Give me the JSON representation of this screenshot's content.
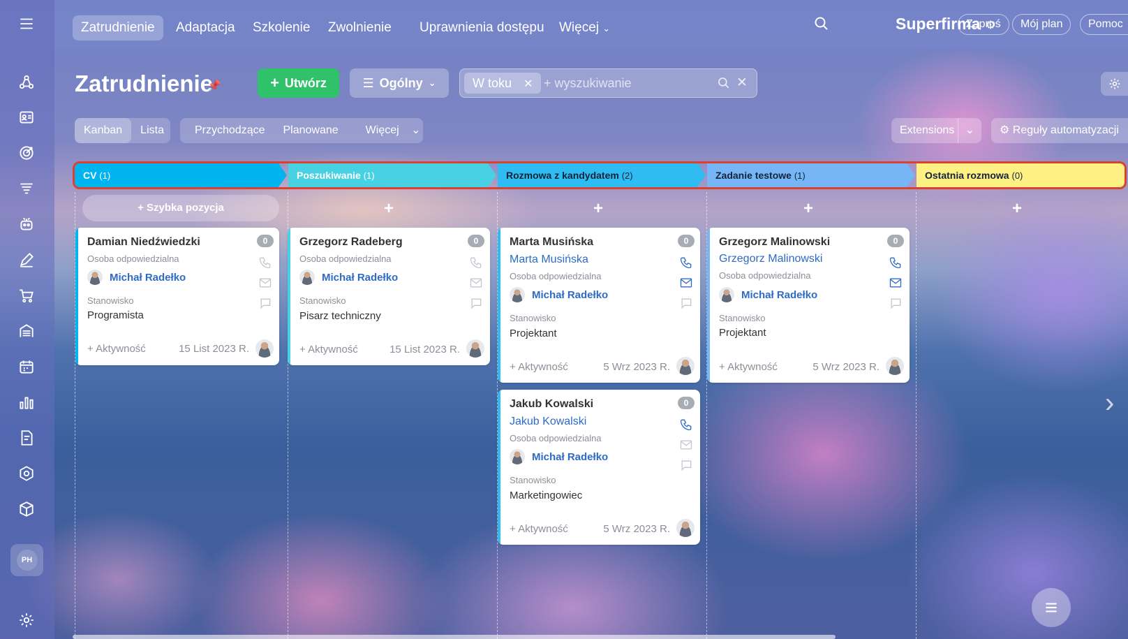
{
  "nav": {
    "tabs": [
      "Zatrudnienie",
      "Adaptacja",
      "Szkolenie",
      "Zwolnienie",
      "Uprawnienia dostępu",
      "Więcej"
    ],
    "brand": "Superfirma",
    "invite": "Zaproś",
    "my_plan": "Mój plan",
    "help": "Pomoc"
  },
  "sidebar": {
    "avatar_initials": "PH",
    "icons": [
      "menu-icon",
      "crm-icon",
      "contacts-icon",
      "goal-icon",
      "filter-icon",
      "robot-icon",
      "sign-icon",
      "cart-icon",
      "warehouse-icon",
      "calendar-icon",
      "analytics-icon",
      "document-icon",
      "hexagon-icon",
      "package-icon",
      "settings-icon"
    ]
  },
  "toolbar": {
    "title": "Zatrudnienie",
    "create": "Utwórz",
    "general": "Ogólny",
    "filter_chip": "W toku",
    "search_placeholder": "+ wyszukiwanie"
  },
  "views": {
    "kanban": "Kanban",
    "list": "Lista",
    "incoming": "Przychodzące",
    "planned": "Planowane",
    "more": "Więcej",
    "extensions": "Extensions",
    "automation": "Reguły automatyzacji"
  },
  "quick_add": "Szybka pozycja",
  "stages": [
    {
      "name": "CV",
      "count": "(1)",
      "color": "#00b4f0"
    },
    {
      "name": "Poszukiwanie",
      "count": "(1)",
      "color": "#47d1e2"
    },
    {
      "name": "Rozmowa z kandydatem",
      "count": "(2)",
      "color": "#2fbcf2"
    },
    {
      "name": "Zadanie testowe",
      "count": "(1)",
      "color": "#76b6f7"
    },
    {
      "name": "Ostatnia rozmowa",
      "count": "(0)",
      "color": "#fff084"
    }
  ],
  "labels": {
    "responsible": "Osoba odpowiedzialna",
    "position": "Stanowisko",
    "activity": "+ Aktywność"
  },
  "cards": [
    {
      "name": "Damian Niedźwiedzki",
      "responsible": "Michał Radełko",
      "position": "Programista",
      "date": "15 List 2023 R.",
      "badge": "0"
    },
    {
      "name": "Grzegorz Radeberg",
      "responsible": "Michał Radełko",
      "position": "Pisarz techniczny",
      "date": "15 List 2023 R.",
      "badge": "0"
    },
    {
      "name": "Marta Musińska",
      "contact": "Marta Musińska",
      "responsible": "Michał Radełko",
      "position": "Projektant",
      "date": "5 Wrz 2023 R.",
      "badge": "0"
    },
    {
      "name": "Jakub Kowalski",
      "contact": "Jakub Kowalski",
      "responsible": "Michał Radełko",
      "position": "Marketingowiec",
      "date": "5 Wrz 2023 R.",
      "badge": "0"
    },
    {
      "name": "Grzegorz Malinowski",
      "contact": "Grzegorz Malinowski",
      "responsible": "Michał Radełko",
      "position": "Projektant",
      "date": "5 Wrz 2023 R.",
      "badge": "0"
    }
  ]
}
